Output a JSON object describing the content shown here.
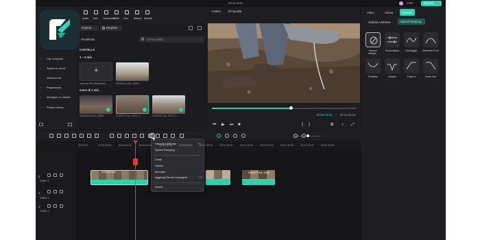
{
  "titlebar": {
    "title": "Senza titolo",
    "credit_count": "3365",
    "export_label": "Esporta"
  },
  "toolbar": {
    "items": [
      {
        "label": "Audio"
      },
      {
        "label": "Titoli"
      },
      {
        "label": "Transizioni"
      },
      {
        "label": "Effetti"
      },
      {
        "label": "Film"
      },
      {
        "label": "Adesivi"
      },
      {
        "label": "Modelli"
      }
    ]
  },
  "sidebar": {
    "items": [
      {
        "label": "Clip composta"
      },
      {
        "label": "Spazio su cloud"
      },
      {
        "label": "Influenza Kit"
      },
      {
        "label": "Regolazione"
      },
      {
        "label": "Immagine in Libreria"
      },
      {
        "label": "Photos Library"
      }
    ]
  },
  "media": {
    "import_label": "Importa",
    "record_label": "Registra",
    "sort_label": "Predefinito",
    "search_placeholder": "Cerca media",
    "folder_label": "CARTELLA",
    "section1": "1 ~ 5 min",
    "section2": "meno di 1 min",
    "clips": [
      {
        "label": "Importa File Multimedi..."
      },
      {
        "label": "2603664-uhd_3840..."
      },
      {
        "label": "16815234-uhd_4096..."
      },
      {
        "label": "5192077-hd_1920_1..."
      },
      {
        "label": "5192157-hd_1920_1..."
      }
    ]
  },
  "player": {
    "mode_label": "Lettore",
    "quality_label": "1/4 Qualità",
    "time_current": "00:00:42:03",
    "time_total": "00:01:16:19"
  },
  "properties": {
    "tabs": [
      {
        "label": "Video"
      },
      {
        "label": "Colore"
      },
      {
        "label": "Velocità"
      }
    ],
    "subtabs": [
      {
        "label": "Velocità Uniforme"
      },
      {
        "label": "Speed Ramping"
      }
    ],
    "presets": [
      {
        "label": "Nessun collega..."
      },
      {
        "label": "Personalizza"
      },
      {
        "label": "Montaggio"
      },
      {
        "label": "Momento Eroe"
      },
      {
        "label": "Proiettile"
      },
      {
        "label": "Jumper"
      },
      {
        "label": "Flash In"
      },
      {
        "label": "Flash Out"
      }
    ]
  },
  "timeline": {
    "ruler": [
      "00:00:00",
      "00:00:35:00",
      "00:00:40:00",
      "00:00:45:00",
      "00:00:50:00",
      "00:00:55:00",
      "00:01:00:00",
      "00:01:05:00",
      "00:01:10:00",
      "00:01:15:00",
      "00:01:20:00",
      "00:01:25:00",
      "00:01:30:00"
    ],
    "tracks": [
      {
        "label": "Video 1"
      },
      {
        "label": "Video 1"
      },
      {
        "label": "Audio 1"
      }
    ],
    "clip_labels": [
      "5192157-hd...",
      "5192077-hd_1920..."
    ]
  },
  "context_menu": {
    "items": [
      {
        "label": "Velocità Uniforme",
        "shortcut": "^R"
      },
      {
        "label": "Speed Ramping",
        "shortcut": ""
      },
      {
        "label": "Lento",
        "shortcut": "›"
      },
      {
        "label": "Veloce",
        "shortcut": "›"
      },
      {
        "label": "Normale",
        "shortcut": ""
      },
      {
        "label": "Aggiungi Fermo Immagine",
        "shortcut": "⌥F"
      },
      {
        "label": "Inverti",
        "shortcut": ""
      }
    ]
  },
  "colors": {
    "accent": "#27d3ad",
    "playhead": "#e6344a",
    "export": "#2ad3b0",
    "speed_tab": "#2ad3b0"
  }
}
